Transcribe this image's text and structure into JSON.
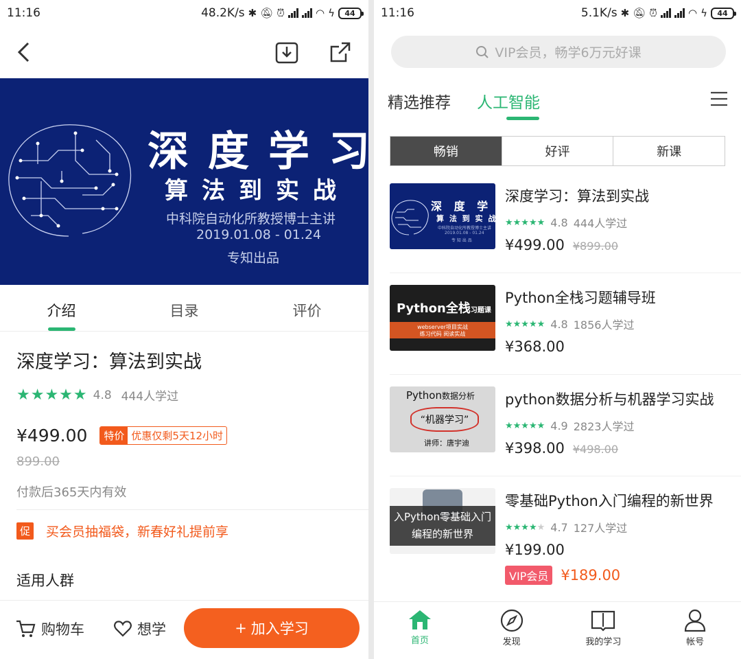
{
  "left": {
    "status": {
      "time": "11:16",
      "net_speed": "48.2K/s",
      "battery": "44"
    },
    "banner": {
      "title": "深度学习",
      "subtitle": "算法到实战",
      "line1": "中科院自动化所教授博士主讲",
      "line2": "2019.01.08 - 01.24",
      "line3": "专知出品"
    },
    "tabs": [
      "介绍",
      "目录",
      "评价"
    ],
    "course": {
      "title": "深度学习：算法到实战",
      "stars": "★★★★★",
      "rating": "4.8",
      "learners": "444人学过",
      "price": "¥499.00",
      "promo_tag": "特价",
      "promo_text": "优惠仅剩5天12小时",
      "original_price": "899.00",
      "validity": "付款后365天内有效",
      "promo_badge": "促",
      "promo_line": "买会员抽福袋，新春好礼提前享",
      "audience_heading": "适用人群"
    },
    "bottom": {
      "cart": "购物车",
      "wish": "想学",
      "join": "加入学习",
      "join_plus": "+"
    },
    "colors": {
      "accent": "#2bb673",
      "orange": "#f4601f",
      "banner_bg": "#0c2275"
    }
  },
  "right": {
    "status": {
      "time": "11:16",
      "net_speed": "5.1K/s",
      "battery": "44"
    },
    "search_placeholder": "VIP会员，畅学6万元好课",
    "categories": [
      "精选推荐",
      "人工智能"
    ],
    "segments": [
      "畅销",
      "好评",
      "新课"
    ],
    "courses": [
      {
        "title": "深度学习：算法到实战",
        "stars": "★★★★★",
        "rating": "4.8",
        "learners": "444人学过",
        "price": "¥499.00",
        "original_price": "¥899.00",
        "thumb": {
          "title": "深 度 学 习",
          "sub": "算 法 到 实 战",
          "small1": "中科院自动化所教授博士主讲",
          "small2": "2019.01.08 - 01.24",
          "small3": "专 知 出 品"
        }
      },
      {
        "title": "Python全栈习题辅导班",
        "stars": "★★★★★",
        "rating": "4.8",
        "learners": "1856人学过",
        "price": "¥368.00",
        "thumb": {
          "title": "Python全栈",
          "title_small": "习题课",
          "tag1": "webserver项目实战",
          "tag2": "练习代码 阅读实战"
        }
      },
      {
        "title": "python数据分析与机器学习实战",
        "stars": "★★★★★",
        "rating": "4.9",
        "learners": "2823人学过",
        "price": "¥398.00",
        "original_price": "¥498.00",
        "thumb": {
          "title": "Python",
          "title_cn": "数据分析",
          "sub": "“机器学习”",
          "teacher": "讲师：唐宇迪"
        }
      },
      {
        "title": "零基础Python入门编程的新世界",
        "stars": "★★★★",
        "star_empty": "★",
        "rating": "4.7",
        "learners": "127人学过",
        "price": "¥199.00",
        "vip_label": "VIP会员",
        "vip_price": "¥189.00",
        "thumb": {
          "line1": "入Python零基础入门",
          "line2": "编程的新世界"
        }
      }
    ],
    "nav": [
      "首页",
      "发现",
      "我的学习",
      "帐号"
    ]
  }
}
